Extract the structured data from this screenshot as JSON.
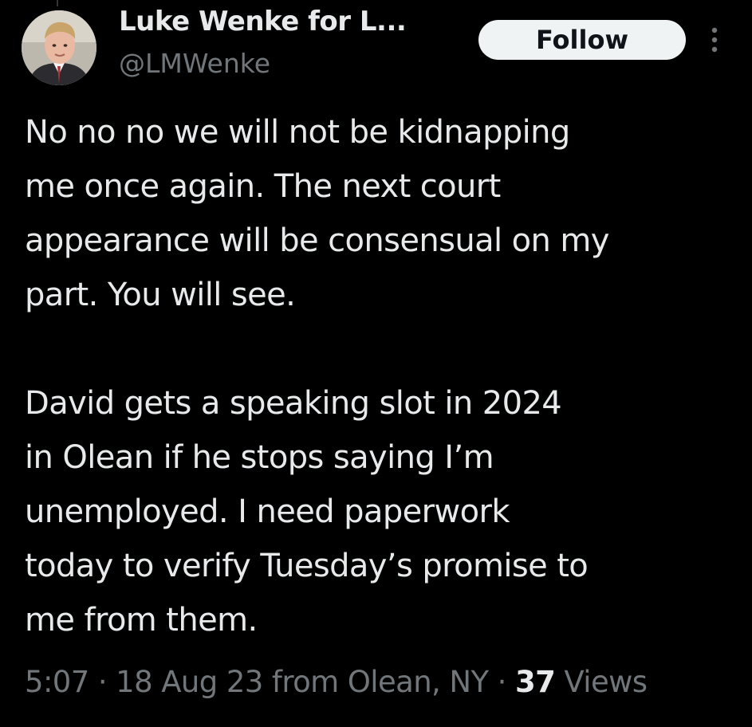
{
  "colors": {
    "background": "#000000",
    "primary_text": "#e7e9ea",
    "secondary_text": "#71767b",
    "follow_button_bg": "#eff3f4",
    "follow_button_text": "#0f1419"
  },
  "author": {
    "display_name": "Luke Wenke for L...",
    "handle": "@LMWenke",
    "avatar_icon": "user-avatar-photo"
  },
  "actions": {
    "follow_label": "Follow",
    "more_icon": "more-vertical-icon"
  },
  "tweet": {
    "paragraphs": [
      "No no no we will not be kidnapping\nme once again.  The next court\nappearance will be consensual on my\npart.  You will see.",
      "David gets a speaking slot in 2024\nin Olean if he stops saying I’m\nunemployed.  I need paperwork\ntoday to verify Tuesday’s promise to\nme from them."
    ]
  },
  "meta": {
    "time": "5:07",
    "date": "18 Aug 23",
    "location": "from Olean, NY",
    "views_count": "37",
    "views_label": "Views"
  }
}
